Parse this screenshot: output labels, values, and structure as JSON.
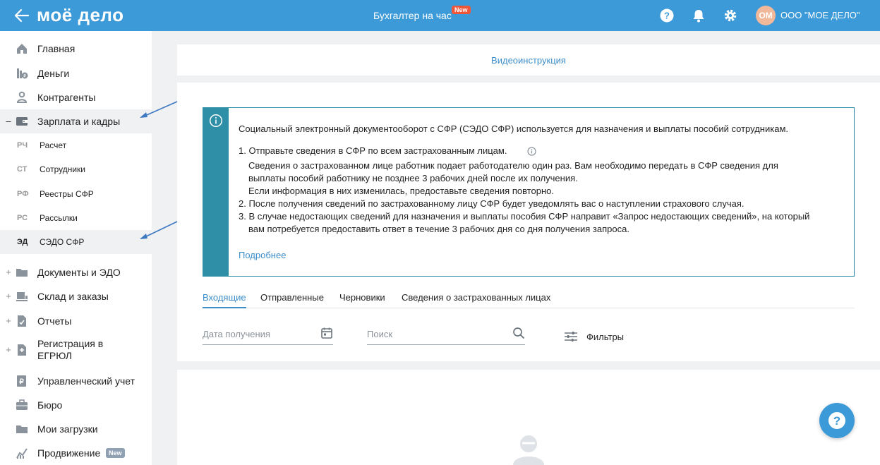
{
  "header": {
    "logo": "моё дело",
    "promo_label": "Бухгалтер на час",
    "promo_badge": "New",
    "avatar_initials": "ОМ",
    "company_name": "ООО \"МОЕ ДЕЛО\""
  },
  "sidebar": {
    "items": [
      {
        "label": "Главная",
        "icon": "home-icon"
      },
      {
        "label": "Деньги",
        "icon": "money-icon"
      },
      {
        "label": "Контрагенты",
        "icon": "contractors-icon"
      },
      {
        "label": "Зарплата и кадры",
        "icon": "wallet-icon",
        "expand": "–"
      },
      {
        "label": "Документы и ЭДО",
        "icon": "folder-icon",
        "expand": "+"
      },
      {
        "label": "Склад и заказы",
        "icon": "warehouse-icon",
        "expand": "+"
      },
      {
        "label": "Отчеты",
        "icon": "report-icon",
        "expand": "+"
      },
      {
        "label": "Регистрация в ЕГРЮЛ",
        "icon": "registration-icon",
        "expand": "+"
      },
      {
        "label": "Управленческий учет",
        "icon": "ruble-doc-icon"
      },
      {
        "label": "Бюро",
        "icon": "briefcase-icon"
      },
      {
        "label": "Мои загрузки",
        "icon": "downloads-folder-icon"
      },
      {
        "label": "Продвижение",
        "icon": "chart-icon",
        "badge": "New"
      }
    ],
    "subitems": [
      {
        "abbr": "РЧ",
        "label": "Расчет"
      },
      {
        "abbr": "СТ",
        "label": "Сотрудники"
      },
      {
        "abbr": "РФ",
        "label": "Реестры СФР"
      },
      {
        "abbr": "РС",
        "label": "Рассылки"
      },
      {
        "abbr": "ЭД",
        "label": "СЭДО СФР"
      }
    ]
  },
  "main": {
    "video_link": "Видеоинструкция",
    "info": {
      "intro": "Социальный электронный документооборот с СФР (СЭДО СФР) используется для назначения и выплаты пособий сотрудникам.",
      "step1": "1. Отправьте сведения в СФР по всем застрахованным лицам.",
      "step1_l1": "Сведения о застрахованном лице работник подает работодателю один раз. Вам необходимо передать в СФР сведения для",
      "step1_l2": "выплаты пособий работнику не позднее 3 рабочих дней после их получения.",
      "step1_l3": "Если информация в них изменилась, предоставьте сведения повторно.",
      "step2": "2. После получения сведений по застрахованному лицу СФР будет уведомлять вас о наступлении страхового случая.",
      "step3_l1": "3. В случае недостающих сведений для назначения и выплаты пособия СФР направит «Запрос недостающих сведений», на который",
      "step3_l2": "вам потребуется предоставить ответ в течение 3 рабочих дня со дня получения запроса.",
      "more_link": "Подробнее"
    },
    "tabs": [
      "Входящие",
      "Отправленные",
      "Черновики",
      "Сведения о застрахованных лицах"
    ],
    "filters": {
      "date_placeholder": "Дата получения",
      "search_placeholder": "Поиск",
      "filters_label": "Фильтры"
    }
  },
  "colors": {
    "brand": "#3d9ad8",
    "info_accent": "#2f8fa6",
    "link": "#3d8ec9",
    "badge_red": "#f0573a"
  }
}
